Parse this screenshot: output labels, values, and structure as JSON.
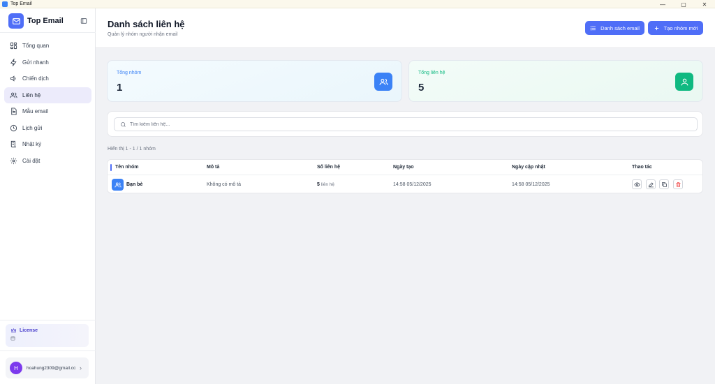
{
  "window": {
    "title": "Top Email",
    "controls": [
      "—",
      "▢",
      "✕"
    ]
  },
  "brand": {
    "name": "Top Email"
  },
  "nav": [
    {
      "key": "dashboard",
      "label": "Tổng quan",
      "icon": "grid-icon"
    },
    {
      "key": "quick-send",
      "label": "Gửi nhanh",
      "icon": "bolt-icon"
    },
    {
      "key": "campaigns",
      "label": "Chiến dịch",
      "icon": "megaphone-icon"
    },
    {
      "key": "contacts",
      "label": "Liên hệ",
      "icon": "users-icon",
      "active": true
    },
    {
      "key": "templates",
      "label": "Mẫu email",
      "icon": "document-icon"
    },
    {
      "key": "schedule",
      "label": "Lịch gửi",
      "icon": "clock-icon"
    },
    {
      "key": "logs",
      "label": "Nhật ký",
      "icon": "scroll-icon"
    },
    {
      "key": "settings",
      "label": "Cài đặt",
      "icon": "gear-icon"
    }
  ],
  "license": {
    "title": "License"
  },
  "user": {
    "initial": "H",
    "email": "hoahung2309@gmail.com"
  },
  "header": {
    "title": "Danh sách liên hệ",
    "subtitle": "Quản lý nhóm người nhận email",
    "email_list_label": "Danh sách email",
    "new_group_label": "Tạo nhóm mới"
  },
  "stats": {
    "groups": {
      "label": "Tổng nhóm",
      "value": "1",
      "color": "#3b82f6"
    },
    "contacts": {
      "label": "Tổng liên hệ",
      "value": "5",
      "color": "#10b981"
    }
  },
  "search": {
    "placeholder": "Tìm kiếm liên hệ...",
    "value": ""
  },
  "showing_text": "Hiển thị 1 - 1 / 1 nhóm",
  "table": {
    "columns": [
      "Tên nhóm",
      "Mô tả",
      "Số liên hệ",
      "Ngày tạo",
      "Ngày cập nhật",
      "Thao tác"
    ],
    "rows": [
      {
        "name": "Bạn bè",
        "description": "Không có mô tả",
        "count": "5",
        "count_unit": "liên hệ",
        "created": "14:58 05/12/2025",
        "updated": "14:58 05/12/2025"
      }
    ]
  },
  "colors": {
    "accent": "#4f6ef7",
    "danger": "#ef4444"
  }
}
